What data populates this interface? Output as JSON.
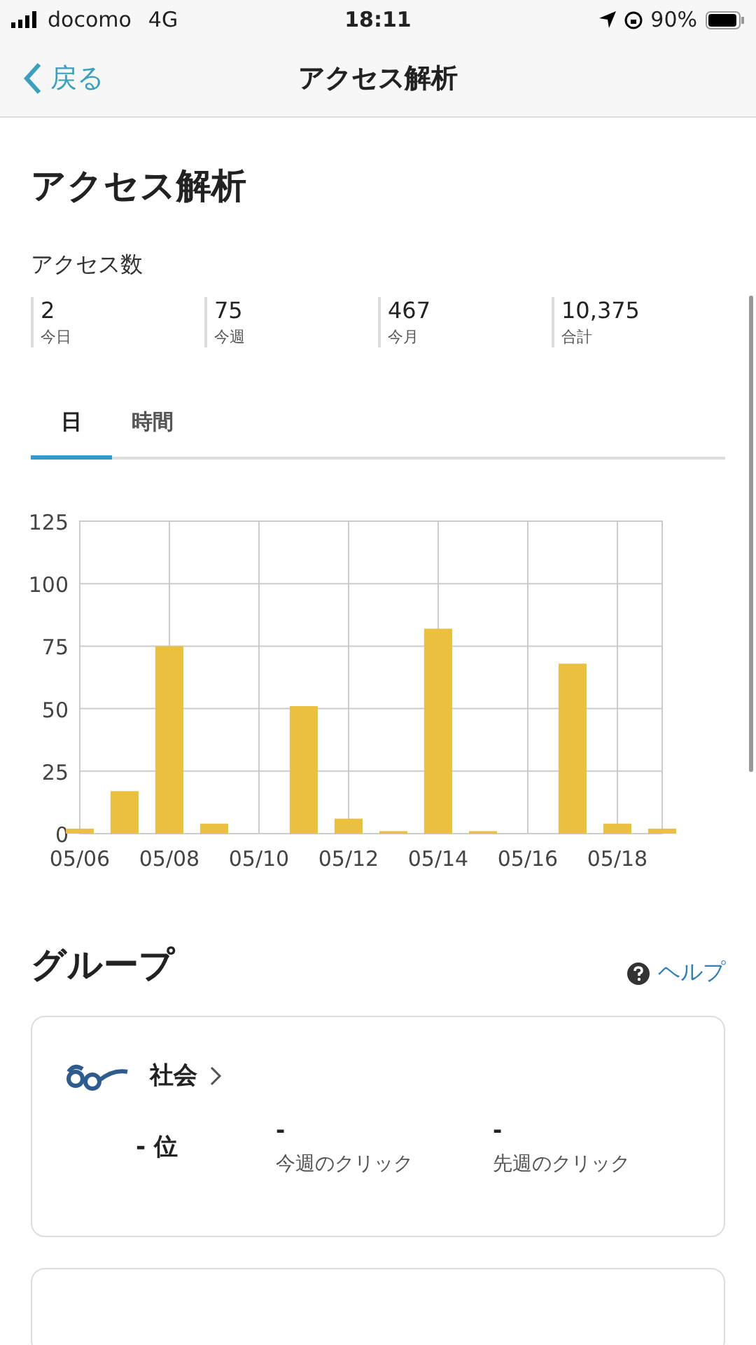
{
  "status_bar": {
    "carrier": "docomo",
    "network": "4G",
    "time": "18:11",
    "battery": "90%"
  },
  "nav": {
    "back": "戻る",
    "title": "アクセス解析"
  },
  "page_title": "アクセス解析",
  "access": {
    "label": "アクセス数",
    "stats": [
      {
        "value": "2",
        "label": "今日"
      },
      {
        "value": "75",
        "label": "今週"
      },
      {
        "value": "467",
        "label": "今月"
      },
      {
        "value": "10,375",
        "label": "合計"
      }
    ]
  },
  "tabs": [
    {
      "label": "日",
      "selected": true
    },
    {
      "label": "時間",
      "selected": false
    }
  ],
  "chart_data": {
    "type": "bar",
    "categories": [
      "05/06",
      null,
      "05/08",
      null,
      "05/10",
      null,
      "05/12",
      null,
      "05/14",
      null,
      "05/16",
      null,
      "05/18",
      null
    ],
    "grid": true,
    "series": [
      {
        "color": "#ebc03f",
        "values": [
          2,
          17,
          75,
          4,
          0,
          51,
          6,
          1,
          82,
          1,
          0,
          68,
          4,
          2
        ]
      }
    ],
    "ylim": [
      0,
      125
    ],
    "yticks": [
      0,
      25,
      50,
      75,
      100,
      125
    ]
  },
  "group": {
    "title": "グループ",
    "help": "ヘルプ",
    "cards": [
      {
        "name": "社会",
        "rank": "-",
        "rank_unit": "位",
        "metrics": [
          {
            "value": "-",
            "label": "今週のクリック"
          },
          {
            "value": "-",
            "label": "先週のクリック"
          }
        ]
      }
    ]
  }
}
